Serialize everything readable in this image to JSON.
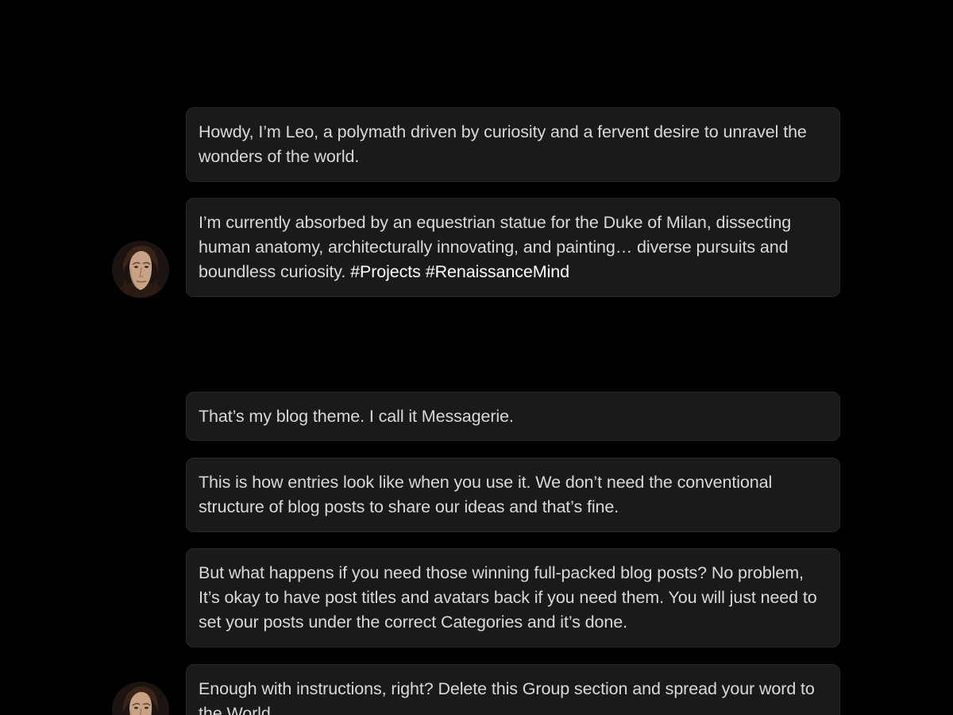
{
  "groups": [
    {
      "messages": [
        "Howdy, I’m Leo, a polymath driven by curiosity and a fervent desire to unravel the wonders of the world.",
        "I’m currently absorbed by an equestrian statue for the Duke of Milan, dissecting human anatomy, architecturally innovating, and painting… diverse pursuits and boundless curiosity."
      ],
      "tags": [
        "#Projects",
        "#RenaissanceMind"
      ]
    },
    {
      "messages": [
        "That’s my blog theme. I call it Messagerie.",
        "This is how entries look like when you use it. We don’t need the conventional structure of blog posts to share our ideas and that’s fine.",
        "But what happens if you need those winning full-packed blog posts? No problem, It’s okay to have post titles and avatars back if you need them. You will just need to set your posts under the correct Categories and it’s done.",
        "Enough with instructions, right? Delete this Group section and spread your word to the World."
      ]
    }
  ],
  "colors": {
    "background": "#000000",
    "bubble": "#1a1a1a",
    "text": "#d9d9d9",
    "tag": "#ffffff"
  },
  "icons": {
    "avatar": "portrait-avatar-icon"
  }
}
